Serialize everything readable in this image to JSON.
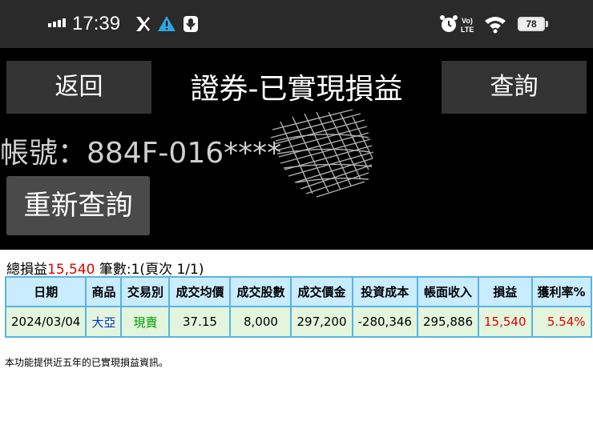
{
  "status_bar": {
    "time": "17:39",
    "battery": "78",
    "icons": [
      "signal-bars-icon",
      "app-notification-icon",
      "warning-icon",
      "microphone-icon",
      "alarm-icon",
      "volte-icon",
      "wifi-icon",
      "battery-icon"
    ],
    "volte_text": "Vo LTE"
  },
  "header": {
    "back_label": "返回",
    "title": "證券-已實現損益",
    "query_label": "查詢",
    "account": "帳號：884F-016****",
    "requery_label": "重新查詢"
  },
  "summary": {
    "total_label": "總損益",
    "total_value": "15,540",
    "count_text": "筆數:1(頁次 1/1)"
  },
  "table": {
    "columns": [
      "日期",
      "商品",
      "交易別",
      "成交均價",
      "成交股數",
      "成交價金",
      "投資成本",
      "帳面收入",
      "損益",
      "獲利率%"
    ],
    "rows": [
      {
        "date": "2024/03/04",
        "product": "大亞",
        "trade_type": "現賣",
        "avg_price": "37.15",
        "shares": "8,000",
        "amount": "297,200",
        "cost": "-280,346",
        "income": "295,886",
        "pnl": "15,540",
        "rate": "5.54%"
      }
    ]
  },
  "footer_note": "本功能提供近五年的已實現損益資訊。",
  "colors": {
    "header_bg": "#000000",
    "button_bg": "#333333",
    "table_border": "#58b3e6",
    "table_header_bg": "#c9ecff",
    "table_row_bg": "#e3f5dc",
    "profit_red": "#e00000",
    "product_blue": "#0033cc",
    "trade_green": "#009900"
  }
}
